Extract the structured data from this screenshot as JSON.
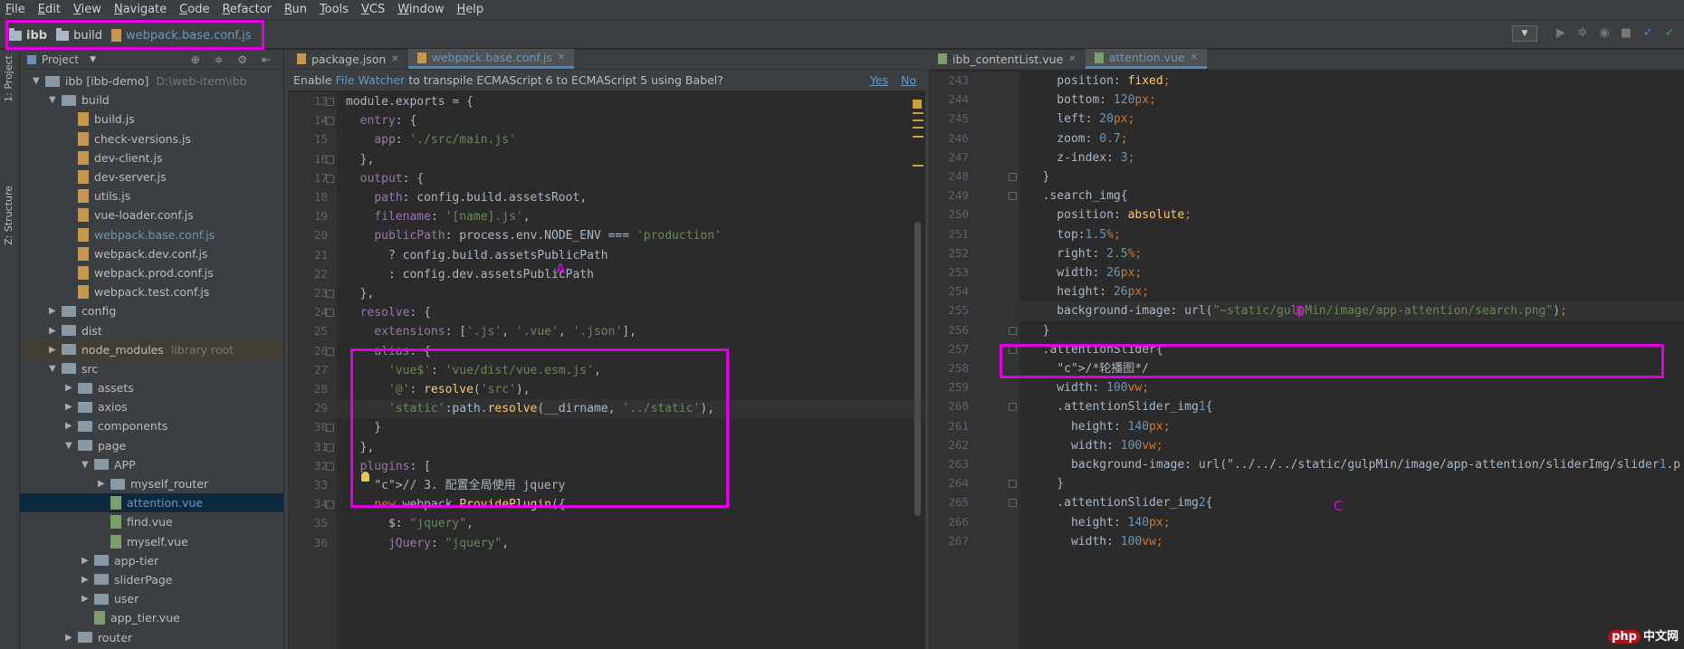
{
  "menu": [
    "File",
    "Edit",
    "View",
    "Navigate",
    "Code",
    "Refactor",
    "Run",
    "Tools",
    "VCS",
    "Window",
    "Help"
  ],
  "breadcrumb": {
    "root": "ibb",
    "folder": "build",
    "file": "webpack.base.conf.js"
  },
  "side_tabs": {
    "project": "1: Project",
    "structure": "Z: Structure"
  },
  "project_panel": {
    "title": "Project",
    "tree": [
      {
        "label": "ibb [ibb-demo]",
        "extra": "D:\\web-item\\ibb",
        "kind": "module",
        "depth": 0,
        "arrow": "▼"
      },
      {
        "label": "build",
        "kind": "folder",
        "depth": 1,
        "arrow": "▼"
      },
      {
        "label": "build.js",
        "kind": "js",
        "depth": 2
      },
      {
        "label": "check-versions.js",
        "kind": "js",
        "depth": 2
      },
      {
        "label": "dev-client.js",
        "kind": "js",
        "depth": 2
      },
      {
        "label": "dev-server.js",
        "kind": "js",
        "depth": 2
      },
      {
        "label": "utils.js",
        "kind": "js",
        "depth": 2
      },
      {
        "label": "vue-loader.conf.js",
        "kind": "js",
        "depth": 2
      },
      {
        "label": "webpack.base.conf.js",
        "kind": "js",
        "depth": 2,
        "active": true
      },
      {
        "label": "webpack.dev.conf.js",
        "kind": "js",
        "depth": 2
      },
      {
        "label": "webpack.prod.conf.js",
        "kind": "js",
        "depth": 2
      },
      {
        "label": "webpack.test.conf.js",
        "kind": "js",
        "depth": 2
      },
      {
        "label": "config",
        "kind": "folder",
        "depth": 1,
        "arrow": "▶"
      },
      {
        "label": "dist",
        "kind": "folder",
        "depth": 1,
        "arrow": "▶"
      },
      {
        "label": "node_modules",
        "extra": "library root",
        "kind": "folder",
        "depth": 1,
        "arrow": "▶",
        "lib": true
      },
      {
        "label": "src",
        "kind": "folder",
        "depth": 1,
        "arrow": "▼"
      },
      {
        "label": "assets",
        "kind": "folder",
        "depth": 2,
        "arrow": "▶"
      },
      {
        "label": "axios",
        "kind": "folder",
        "depth": 2,
        "arrow": "▶"
      },
      {
        "label": "components",
        "kind": "folder",
        "depth": 2,
        "arrow": "▶"
      },
      {
        "label": "page",
        "kind": "folder",
        "depth": 2,
        "arrow": "▼"
      },
      {
        "label": "APP",
        "kind": "folder",
        "depth": 3,
        "arrow": "▼"
      },
      {
        "label": "myself_router",
        "kind": "folder",
        "depth": 4,
        "arrow": "▶"
      },
      {
        "label": "attention.vue",
        "kind": "vue",
        "depth": 4,
        "selected": true
      },
      {
        "label": "find.vue",
        "kind": "vue",
        "depth": 4
      },
      {
        "label": "myself.vue",
        "kind": "vue",
        "depth": 4
      },
      {
        "label": "app-tier",
        "kind": "folder",
        "depth": 3,
        "arrow": "▶"
      },
      {
        "label": "sliderPage",
        "kind": "folder",
        "depth": 3,
        "arrow": "▶"
      },
      {
        "label": "user",
        "kind": "folder",
        "depth": 3,
        "arrow": "▶"
      },
      {
        "label": "app_tier.vue",
        "kind": "vue",
        "depth": 3
      },
      {
        "label": "router",
        "kind": "folder",
        "depth": 2,
        "arrow": "▶"
      }
    ]
  },
  "editor_left": {
    "tabs": [
      {
        "label": "package.json",
        "active": false
      },
      {
        "label": "webpack.base.conf.js",
        "active": true
      }
    ],
    "banner": {
      "prefix": "Enable",
      "link": "File Watcher",
      "suffix": "to transpile ECMAScript 6 to ECMAScript 5 using Babel?",
      "yes": "Yes",
      "no": "No"
    },
    "first_line": 13,
    "lines": [
      "module.exports = {",
      "  entry: {",
      "    app: './src/main.js'",
      "  },",
      "  output: {",
      "    path: config.build.assetsRoot,",
      "    filename: '[name].js',",
      "    publicPath: process.env.NODE_ENV === 'production'",
      "      ? config.build.assetsPublicPath",
      "      : config.dev.assetsPublicPath",
      "  },",
      "  resolve: {",
      "    extensions: ['.js', '.vue', '.json'],",
      "    alias: {",
      "      'vue$': 'vue/dist/vue.esm.js',",
      "      '@': resolve('src'),",
      "      'static':path.resolve(__dirname, '../static'),",
      "    }",
      "  },",
      "  plugins: [",
      "    // 3. 配置全局使用 jquery",
      "    new webpack.ProvidePlugin({",
      "      $: \"jquery\",",
      "      jQuery: \"jquery\","
    ],
    "annotation": "A"
  },
  "editor_right": {
    "tabs": [
      {
        "label": "ibb_contentList.vue",
        "active": false
      },
      {
        "label": "attention.vue",
        "active": true
      }
    ],
    "first_line": 243,
    "lines": [
      "    position: fixed;",
      "    bottom: 120px;",
      "    left: 20px;",
      "    zoom: 0.7;",
      "    z-index: 3;",
      "  }",
      "  .search_img{",
      "    position: absolute;",
      "    top:1.5%;",
      "    right: 2.5%;",
      "    width: 26px;",
      "    height: 26px;",
      "    background-image: url(\"~static/gulpMin/image/app-attention/search.png\");",
      "  }",
      "  .attentionSlider{",
      "    /*轮播图*/",
      "    width: 100vw;",
      "    .attentionSlider_img1{",
      "      height: 140px;",
      "      width: 100vw;",
      "      background-image: url(\"../../../static/gulpMin/image/app-attention/sliderImg/slider1.p",
      "    }",
      "    .attentionSlider_img2{",
      "      height: 140px;",
      "      width: 100vw;"
    ],
    "annotation_b": "B",
    "annotation_c": "C"
  },
  "watermark": {
    "badge": "php",
    "text": "中文网"
  },
  "colors": {
    "highlight": "#e100e1",
    "background": "#2b2b2b",
    "panel": "#3c3f41"
  }
}
